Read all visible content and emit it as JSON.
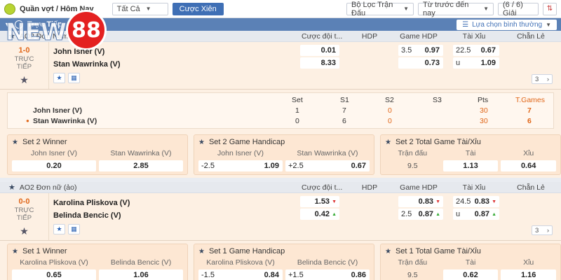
{
  "topbar": {
    "sport": "Quần vợt / Hôm Nay",
    "filter_all": "Tất Cả",
    "parlay_button": "Cược Xiên",
    "match_filter": "Bộ Lọc Trận Đấu",
    "sort": "Từ trước đến nay",
    "league_count": "(6 / 6) Giải"
  },
  "logo": {
    "text1": "NEW",
    "text2": "88"
  },
  "section": {
    "title": "Trực Tiếp",
    "display_select": "Lựa chọn bình thường"
  },
  "columns": {
    "full_time": "Cược đội t...",
    "hdp": "HDP",
    "game_hdp": "Game HDP",
    "over_under": "Tài Xỉu",
    "odd_even": "Chẵn Lẻ"
  },
  "match1": {
    "league": "AO2 Đơn Nam",
    "score": "1-0",
    "live_line1": "TRỰC",
    "live_line2": "TIẾP",
    "team1": "John Isner (V)",
    "team2": "Stan Wawrinka (V)",
    "ft_home": "0.01",
    "ft_away": "8.33",
    "ghdp_line": "3.5",
    "ghdp_home": "0.97",
    "ghdp_away": "0.73",
    "ou_line": "22.5",
    "ou_over": "0.67",
    "ou_u_label": "u",
    "ou_under": "1.09",
    "more_count": "3",
    "stats": {
      "headers": [
        "Set",
        "S1",
        "S2",
        "S3",
        "Pts",
        "T.Games"
      ],
      "row1": [
        "John Isner (V)",
        "1",
        "7",
        "0",
        "",
        "30",
        "7"
      ],
      "row2": [
        "Stan Wawrinka (V)",
        "0",
        "6",
        "0",
        "",
        "30",
        "6"
      ]
    },
    "markets": [
      {
        "title": "Set 2 Winner",
        "labels": [
          "John Isner (V)",
          "Stan Wawrinka (V)"
        ],
        "values": [
          "0.20",
          "2.85"
        ]
      },
      {
        "title": "Set 2 Game Handicap",
        "labels": [
          "John Isner (V)",
          "Stan Wawrinka (V)"
        ],
        "pre": [
          "-2.5",
          "+2.5"
        ],
        "values": [
          "1.09",
          "0.67"
        ]
      },
      {
        "title": "Set 2 Total Game Tài/Xỉu",
        "labels": [
          "Trận đấu",
          "Tài",
          "Xỉu"
        ],
        "values": [
          "9.5",
          "1.13",
          "0.64"
        ]
      }
    ]
  },
  "match2": {
    "league": "AO2 Đơn nữ (ảo)",
    "score": "0-0",
    "live_line1": "TRỰC",
    "live_line2": "TIẾP",
    "team1": "Karolina Pliskova (V)",
    "team2": "Belinda Bencic (V)",
    "ft_home": "1.53",
    "ft_away": "0.42",
    "ghdp_line": "2.5",
    "ghdp_home": "0.83",
    "ghdp_away": "0.87",
    "ou_line": "24.5",
    "ou_over": "0.83",
    "ou_u_label": "u",
    "ou_under": "0.87",
    "more_count": "3",
    "markets": [
      {
        "title": "Set 1 Winner",
        "labels": [
          "Karolina Pliskova (V)",
          "Belinda Bencic (V)"
        ],
        "values": [
          "0.65",
          "1.06"
        ]
      },
      {
        "title": "Set 1 Game Handicap",
        "labels": [
          "Karolina Pliskova (V)",
          "Belinda Bencic (V)"
        ],
        "pre": [
          "-1.5",
          "+1.5"
        ],
        "values": [
          "0.84",
          "0.86"
        ]
      },
      {
        "title": "Set 1 Total Game Tài/Xỉu",
        "labels": [
          "Trận đấu",
          "Tài",
          "Xỉu"
        ],
        "values": [
          "9.5",
          "0.62",
          "1.16"
        ]
      }
    ]
  },
  "colors": {
    "accent": "#3f6fb5",
    "score": "#e0671a",
    "highlight_pts": "#e0671a",
    "up": "#33aa33",
    "down": "#dd3333"
  }
}
